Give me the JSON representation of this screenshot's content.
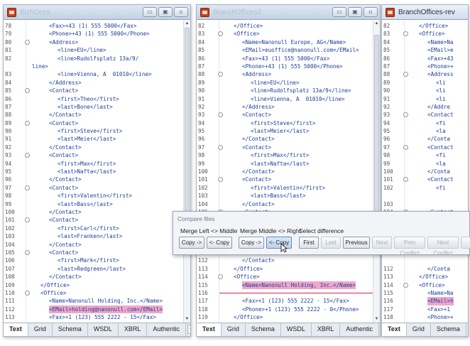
{
  "panes": [
    {
      "title": "BizhOces",
      "active": false,
      "tabs": [
        "Text",
        "Grid",
        "Schema",
        "WSDL",
        "XBRL",
        "Authentic"
      ],
      "active_tab": "Text",
      "lines": [
        {
          "n": "78",
          "code": "<Fax>+43 (1) 555 5000</Fax>",
          "indent": 4
        },
        {
          "n": "79",
          "code": "<Phone>+43 (1) 555 5000</Phone>",
          "indent": 4
        },
        {
          "n": "80",
          "code": "<Address>",
          "indent": 4,
          "fold": true
        },
        {
          "n": "81",
          "code": "<line>EU</line>",
          "indent": 6
        },
        {
          "n": "82",
          "code": "<line>Rudolfsplatz 13a/9/",
          "indent": 6
        },
        {
          "n": "",
          "code": "line>",
          "indent": 0
        },
        {
          "n": "83",
          "code": "<line>Vienna, A  01010</line>",
          "indent": 6
        },
        {
          "n": "84",
          "code": "</Address>",
          "indent": 4
        },
        {
          "n": "85",
          "code": "<Contact>",
          "indent": 4,
          "fold": true
        },
        {
          "n": "86",
          "code": "<first>Theo</first>",
          "indent": 6
        },
        {
          "n": "87",
          "code": "<last>Bone</last>",
          "indent": 6
        },
        {
          "n": "88",
          "code": "</Contact>",
          "indent": 4
        },
        {
          "n": "89",
          "code": "<Contact>",
          "indent": 4,
          "fold": true
        },
        {
          "n": "90",
          "code": "<first>Steve</first>",
          "indent": 6
        },
        {
          "n": "91",
          "code": "<last>Meier</last>",
          "indent": 6
        },
        {
          "n": "92",
          "code": "</Contact>",
          "indent": 4
        },
        {
          "n": "93",
          "code": "<Contact>",
          "indent": 4,
          "fold": true
        },
        {
          "n": "94",
          "code": "<first>Max</first>",
          "indent": 6
        },
        {
          "n": "95",
          "code": "<last>Nafta</last>",
          "indent": 6
        },
        {
          "n": "96",
          "code": "</Contact>",
          "indent": 4
        },
        {
          "n": "97",
          "code": "<Contact>",
          "indent": 4,
          "fold": true
        },
        {
          "n": "98",
          "code": "<first>Valentin</first>",
          "indent": 6
        },
        {
          "n": "99",
          "code": "<last>Bass</last>",
          "indent": 6
        },
        {
          "n": "100",
          "code": "</Contact>",
          "indent": 4
        },
        {
          "n": "101",
          "code": "<Contact>",
          "indent": 4,
          "fold": true
        },
        {
          "n": "102",
          "code": "<first>Carl</first>",
          "indent": 6
        },
        {
          "n": "103",
          "code": "<last>Franken</last>",
          "indent": 6
        },
        {
          "n": "104",
          "code": "</Contact>",
          "indent": 4
        },
        {
          "n": "105",
          "code": "<Contact>",
          "indent": 4,
          "fold": true
        },
        {
          "n": "106",
          "code": "<first>Mark</first>",
          "indent": 6
        },
        {
          "n": "107",
          "code": "<last>Redgreen</last>",
          "indent": 6
        },
        {
          "n": "108",
          "code": "</Contact>",
          "indent": 4
        },
        {
          "n": "109",
          "code": "</Office>",
          "indent": 2
        },
        {
          "n": "110",
          "code": "<Office>",
          "indent": 2,
          "fold": true
        },
        {
          "n": "111",
          "code": "<Name>Nanonull Holding, Inc.</Name>",
          "indent": 4
        },
        {
          "n": "112",
          "code": "<EMail>holding@nanonull.com</EMail>",
          "indent": 4,
          "diff": true
        },
        {
          "n": "113",
          "code": "<Fax>+1 (123) 555 2222 - 15</Fax>",
          "indent": 4
        },
        {
          "n": "114",
          "code": "<Phone>+1 (123) 555 2222 - 0</",
          "indent": 4
        },
        {
          "n": "",
          "code": "Phone>",
          "indent": 0
        },
        {
          "n": "115",
          "code": "</Office>",
          "indent": 2
        }
      ]
    },
    {
      "title": "BranchOffices2",
      "active": false,
      "tabs": [
        "Text",
        "Grid",
        "Schema",
        "WSDL",
        "XBRL",
        "Authentic"
      ],
      "active_tab": "Text",
      "lines": [
        {
          "n": "82",
          "code": "</Office>",
          "indent": 2
        },
        {
          "n": "83",
          "code": "<Office>",
          "indent": 2,
          "fold": true
        },
        {
          "n": "84",
          "code": "<Name>Nanonull Europe, AG</Name>",
          "indent": 4
        },
        {
          "n": "85",
          "code": "<EMail>euoffice@nanonull.com</EMail>",
          "indent": 4
        },
        {
          "n": "86",
          "code": "<Fax>+43 (1) 555 5000</Fax>",
          "indent": 4
        },
        {
          "n": "87",
          "code": "<Phone>+43 (1) 555 5000</Phone>",
          "indent": 4
        },
        {
          "n": "88",
          "code": "<Address>",
          "indent": 4,
          "fold": true
        },
        {
          "n": "89",
          "code": "<line>EU</line>",
          "indent": 6
        },
        {
          "n": "90",
          "code": "<line>Rudolfsplatz 13a/9</line>",
          "indent": 6
        },
        {
          "n": "91",
          "code": "<line>Vienna, A  01010</line>",
          "indent": 6
        },
        {
          "n": "92",
          "code": "</Address>",
          "indent": 4
        },
        {
          "n": "93",
          "code": "<Contact>",
          "indent": 4,
          "fold": true
        },
        {
          "n": "94",
          "code": "<first>Steve</first>",
          "indent": 6
        },
        {
          "n": "95",
          "code": "<last>Meier</last>",
          "indent": 6
        },
        {
          "n": "96",
          "code": "</Contact>",
          "indent": 4
        },
        {
          "n": "97",
          "code": "<Contact>",
          "indent": 4,
          "fold": true
        },
        {
          "n": "98",
          "code": "<first>Max</first>",
          "indent": 6
        },
        {
          "n": "99",
          "code": "<last>Nafta</last>",
          "indent": 6
        },
        {
          "n": "100",
          "code": "</Contact>",
          "indent": 4
        },
        {
          "n": "101",
          "code": "<Contact>",
          "indent": 4,
          "fold": true
        },
        {
          "n": "102",
          "code": "<first>Valentin</first>",
          "indent": 6
        },
        {
          "n": "103",
          "code": "<last>Bass</last>",
          "indent": 6
        },
        {
          "n": "104",
          "code": "</Contact>",
          "indent": 4
        },
        {
          "n": "105",
          "code": "<Contact>",
          "indent": 4,
          "fold": true
        },
        {
          "n": "106",
          "code": "<first>Carl</first>",
          "indent": 6
        },
        {
          "n": "",
          "code": "",
          "indent": 0
        },
        {
          "n": "",
          "code": "",
          "indent": 0
        },
        {
          "n": "",
          "code": "",
          "indent": 0
        },
        {
          "n": "",
          "code": "",
          "indent": 0
        },
        {
          "n": "112",
          "code": "</Contact>",
          "indent": 4
        },
        {
          "n": "113",
          "code": "</Office>",
          "indent": 2
        },
        {
          "n": "114",
          "code": "<Office>",
          "indent": 2,
          "fold": true
        },
        {
          "n": "115",
          "code": "<Name>Nanonull Holding, Inc.</Name>",
          "indent": 4,
          "diff": true
        },
        {
          "n": "116",
          "code": "",
          "indent": 0,
          "diffline": true
        },
        {
          "n": "117",
          "code": "<Fax>+1 (123) 555 2222 - 15</Fax>",
          "indent": 4
        },
        {
          "n": "118",
          "code": "<Phone>+1 (123) 555 2222 - 0</Phone>",
          "indent": 4
        },
        {
          "n": "119",
          "code": "</Office>",
          "indent": 2
        },
        {
          "n": "120",
          "code": "</BranchOffices>",
          "indent": 0
        },
        {
          "n": "121",
          "code": "",
          "indent": 0
        }
      ]
    },
    {
      "title": "BranchOffices-rev",
      "active": true,
      "tabs": [
        "Text",
        "Grid",
        "Schema"
      ],
      "active_tab": "Text",
      "lines": [
        {
          "n": "82",
          "code": "</Office>",
          "indent": 2
        },
        {
          "n": "83",
          "code": "<Office>",
          "indent": 2,
          "fold": true
        },
        {
          "n": "84",
          "code": "<Name>Na",
          "indent": 4
        },
        {
          "n": "85",
          "code": "<EMail>e",
          "indent": 4
        },
        {
          "n": "86",
          "code": "<Fax>+43",
          "indent": 4
        },
        {
          "n": "87",
          "code": "<Phone>+",
          "indent": 4
        },
        {
          "n": "88",
          "code": "<Address",
          "indent": 4,
          "fold": true
        },
        {
          "n": "89",
          "code": "<li",
          "indent": 6
        },
        {
          "n": "90",
          "code": "<li",
          "indent": 6
        },
        {
          "n": "91",
          "code": "<li",
          "indent": 6
        },
        {
          "n": "92",
          "code": "</Addre",
          "indent": 4
        },
        {
          "n": "93",
          "code": "<Contact",
          "indent": 4,
          "fold": true
        },
        {
          "n": "94",
          "code": "<fi",
          "indent": 6
        },
        {
          "n": "95",
          "code": "<la",
          "indent": 6
        },
        {
          "n": "96",
          "code": "</Conta",
          "indent": 4
        },
        {
          "n": "97",
          "code": "<Contact",
          "indent": 4,
          "fold": true
        },
        {
          "n": "98",
          "code": "<fi",
          "indent": 6
        },
        {
          "n": "99",
          "code": "<la",
          "indent": 6
        },
        {
          "n": "100",
          "code": "</Conta",
          "indent": 4
        },
        {
          "n": "101",
          "code": "<Contact",
          "indent": 4,
          "fold": true
        },
        {
          "n": "102",
          "code": "<fi",
          "indent": 6
        },
        {
          "n": "",
          "code": "",
          "indent": 0
        },
        {
          "n": "103",
          "code": "",
          "indent": 0
        },
        {
          "n": "104",
          "code": "<Contact",
          "indent": 4,
          "fold": true
        },
        {
          "n": "105",
          "code": "<Contact",
          "indent": 4
        },
        {
          "n": "106",
          "code": "<fi",
          "indent": 6
        },
        {
          "n": "",
          "code": "",
          "indent": 0
        },
        {
          "n": "",
          "code": "",
          "indent": 0
        },
        {
          "n": "",
          "code": "",
          "indent": 0
        },
        {
          "n": "",
          "code": "",
          "indent": 0
        },
        {
          "n": "112",
          "code": "</Conta",
          "indent": 4
        },
        {
          "n": "113",
          "code": "</Office>",
          "indent": 2
        },
        {
          "n": "114",
          "code": "<Office>",
          "indent": 2,
          "fold": true
        },
        {
          "n": "115",
          "code": "<Name>Na",
          "indent": 4
        },
        {
          "n": "116",
          "code": "<EMail>h",
          "indent": 4,
          "diff": true
        },
        {
          "n": "117",
          "code": "<Fax>+1",
          "indent": 4
        },
        {
          "n": "118",
          "code": "<Phone>+",
          "indent": 4
        },
        {
          "n": "119",
          "code": "</Office>",
          "indent": 2
        },
        {
          "n": "120",
          "code": "</BranchOffices",
          "indent": 0
        },
        {
          "n": "121",
          "code": "",
          "indent": 0
        }
      ]
    }
  ],
  "compare": {
    "title": "Compare files",
    "group_left": "Merge Left <> Middle",
    "group_middle": "Merge Middle <> Right",
    "group_select": "Select difference",
    "buttons": {
      "copy_right_1": "Copy ->",
      "copy_left_1": "<- Copy",
      "copy_right_2": "Copy ->",
      "copy_left_2": "<- Copy",
      "first": "First",
      "last": "Last",
      "previous": "Previous",
      "next": "Next",
      "prev_conflict": "Prev Conflict",
      "next_conflict": "Next Conflict"
    }
  },
  "window_buttons": [
    "▭",
    "▣",
    "▫"
  ],
  "colors": {
    "diff_highlight": "#f0a7c9",
    "tag_blue": "#1d3d9a",
    "diff_line": "#d9263b"
  }
}
